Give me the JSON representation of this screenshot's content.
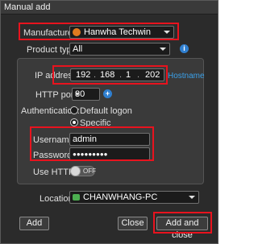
{
  "window": {
    "title": "Manual add"
  },
  "manufacturer": {
    "label": "Manufacturer:",
    "value": "Hanwha Techwin"
  },
  "product_type": {
    "label": "Product type:",
    "value": "All"
  },
  "ip": {
    "label": "IP address:",
    "octets": [
      "192",
      "168",
      "1",
      "202"
    ],
    "hostname_link": "Hostname"
  },
  "http_port": {
    "label": "HTTP port:",
    "value": "80"
  },
  "authentication": {
    "label": "Authentication:",
    "options": [
      {
        "label": "Default logon",
        "checked": false
      },
      {
        "label": "Specific",
        "checked": true
      }
    ]
  },
  "username": {
    "label": "Username:",
    "value": "admin"
  },
  "password": {
    "label": "Password:",
    "value": "●●●●●●●●●"
  },
  "https": {
    "label": "Use HTTPS:",
    "state": "OFF"
  },
  "location": {
    "label": "Location:",
    "value": "CHANWHANG-PC"
  },
  "buttons": {
    "add": "Add",
    "close": "Close",
    "add_and_close": "Add and close"
  },
  "colors": {
    "highlight": "#e8131e",
    "accent": "#3aa0e8",
    "window_bg": "#2b2b2b"
  },
  "icons": [
    "hanwha-logo-icon",
    "info-icon",
    "add-icon",
    "computer-icon",
    "chevron-down-icon"
  ]
}
